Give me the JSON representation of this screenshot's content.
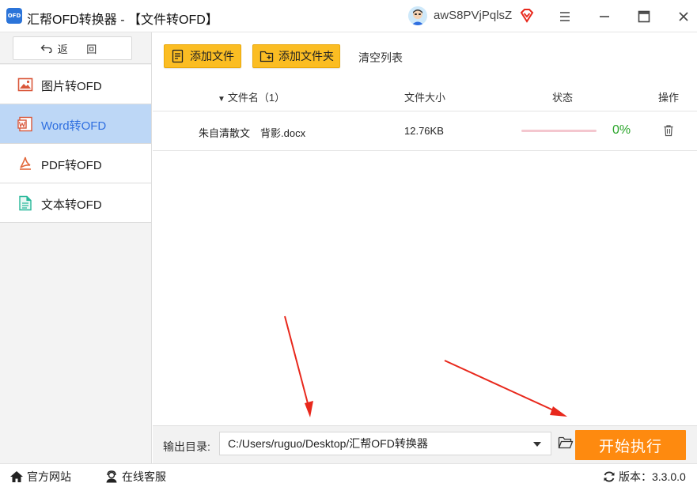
{
  "window": {
    "title": "汇帮OFD转换器 - 【文件转OFD】",
    "logo_text": "OFD",
    "username": "awS8PVjPqlsZ"
  },
  "sidebar": {
    "back_label": "返 回",
    "items": [
      {
        "label": "图片转OFD",
        "icon": "image-icon",
        "active": false
      },
      {
        "label": "Word转OFD",
        "icon": "word-icon",
        "active": true
      },
      {
        "label": "PDF转OFD",
        "icon": "pdf-icon",
        "active": false
      },
      {
        "label": "文本转OFD",
        "icon": "text-file-icon",
        "active": false
      }
    ]
  },
  "toolbar": {
    "add_file": "添加文件",
    "add_folder": "添加文件夹",
    "clear_list": "清空列表"
  },
  "table": {
    "headers": {
      "name": "文件名（1）",
      "size": "文件大小",
      "status": "状态",
      "action": "操作"
    },
    "rows": [
      {
        "name": "朱自清散文　背影.docx",
        "size": "12.76KB",
        "progress": 0,
        "progress_text": "0%"
      }
    ]
  },
  "output": {
    "label": "输出目录:",
    "path": "C:/Users/ruguo/Desktop/汇帮OFD转换器",
    "start_label": "开始执行"
  },
  "statusbar": {
    "website": "官方网站",
    "support": "在线客服",
    "version": "版本：3.3.0.0"
  },
  "colors": {
    "accent_yellow": "#fbbd23",
    "start_orange": "#fe8a0f",
    "active_blue": "#bdd7f6",
    "progress_green": "#2aa52a",
    "annotation_red": "#e8281c"
  }
}
